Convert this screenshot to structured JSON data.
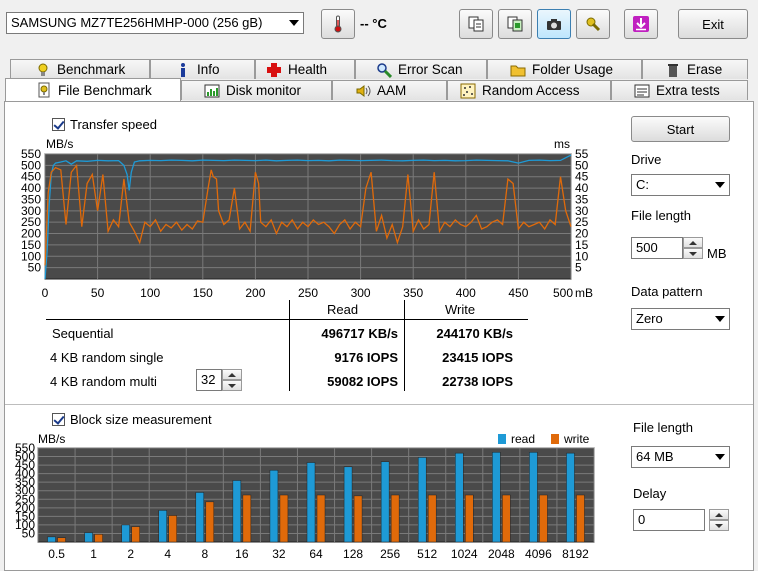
{
  "toolbar": {
    "drive_select": "SAMSUNG MZ7TE256HMHP-000 (256 gB)",
    "temperature": "-- °C",
    "exit_label": "Exit"
  },
  "tabs_top": [
    {
      "label": "Benchmark",
      "icon": "thermometer-icon"
    },
    {
      "label": "Info",
      "icon": "info-icon"
    },
    {
      "label": "Health",
      "icon": "health-cross-icon"
    },
    {
      "label": "Error Scan",
      "icon": "magnifier-icon"
    },
    {
      "label": "Folder Usage",
      "icon": "folder-icon"
    },
    {
      "label": "Erase",
      "icon": "trash-icon"
    }
  ],
  "tabs_bottom": [
    {
      "label": "File Benchmark",
      "icon": "file-benchmark-icon",
      "selected": true
    },
    {
      "label": "Disk monitor",
      "icon": "disk-monitor-icon"
    },
    {
      "label": "AAM",
      "icon": "speaker-icon"
    },
    {
      "label": "Random Access",
      "icon": "random-access-icon"
    },
    {
      "label": "Extra tests",
      "icon": "extra-tests-icon"
    }
  ],
  "transfer": {
    "checkbox_label": "Transfer speed",
    "left_unit": "MB/s",
    "right_unit": "ms",
    "x_unit": "mB"
  },
  "results": {
    "read_header": "Read",
    "write_header": "Write",
    "rows": [
      {
        "label": "Sequential",
        "read": "496717 KB/s",
        "write": "244170 KB/s"
      },
      {
        "label": "4 KB random single",
        "read": "9176 IOPS",
        "write": "23415 IOPS"
      },
      {
        "label": "4 KB random multi",
        "read": "59082 IOPS",
        "write": "22738 IOPS"
      }
    ],
    "queue_depth": "32"
  },
  "block": {
    "checkbox_label": "Block size measurement",
    "unit": "MB/s",
    "legend_read": "read",
    "legend_write": "write"
  },
  "right_panel": {
    "start_label": "Start",
    "drive_label": "Drive",
    "drive_value": "C:",
    "file_length_label": "File length",
    "file_length_value": "500",
    "file_length_unit": "MB",
    "pattern_label": "Data pattern",
    "pattern_value": "Zero",
    "block_file_length_label": "File length",
    "block_file_length_value": "64 MB",
    "delay_label": "Delay",
    "delay_value": "0"
  },
  "colors": {
    "read": "#1e9ad6",
    "write": "#e06a0a",
    "plot_bg": "#4a4a4a",
    "grid": "#7a7a7a"
  },
  "chart_data": [
    {
      "type": "line",
      "title": "Transfer speed",
      "xlim": [
        0,
        500
      ],
      "x_ticks": [
        0,
        50,
        100,
        150,
        200,
        250,
        300,
        350,
        400,
        450,
        500
      ],
      "ylim": [
        0,
        550
      ],
      "y_ticks": [
        50,
        100,
        150,
        200,
        250,
        300,
        350,
        400,
        450,
        500,
        550
      ],
      "y2lim": [
        0,
        55
      ],
      "y2_ticks": [
        5,
        10,
        15,
        20,
        25,
        30,
        35,
        40,
        45,
        50,
        55
      ],
      "grid": true,
      "series": [
        {
          "name": "read",
          "x": [
            0,
            2,
            4,
            6,
            8,
            10,
            15,
            20,
            25,
            30,
            40,
            50,
            60,
            70,
            75,
            78,
            80,
            82,
            85,
            90,
            100,
            110,
            120,
            130,
            140,
            150,
            160,
            170,
            180,
            190,
            200,
            210,
            220,
            230,
            240,
            250,
            260,
            270,
            280,
            290,
            300,
            310,
            320,
            330,
            340,
            350,
            360,
            370,
            380,
            390,
            400,
            410,
            420,
            430,
            440,
            450,
            460,
            470,
            480,
            490,
            500
          ],
          "y": [
            0,
            120,
            330,
            460,
            500,
            510,
            515,
            520,
            505,
            520,
            518,
            522,
            520,
            521,
            500,
            460,
            390,
            470,
            515,
            520,
            522,
            521,
            523,
            522,
            520,
            523,
            522,
            521,
            523,
            522,
            521,
            523,
            520,
            522,
            523,
            521,
            522,
            520,
            523,
            522,
            521,
            522,
            523,
            521,
            520,
            522,
            523,
            521,
            522,
            520,
            521,
            523,
            522,
            521,
            520,
            510,
            522,
            523,
            521,
            522,
            545
          ]
        },
        {
          "name": "write",
          "x": [
            0,
            3,
            6,
            10,
            15,
            20,
            25,
            30,
            35,
            40,
            45,
            50,
            55,
            60,
            65,
            70,
            75,
            80,
            85,
            90,
            95,
            100,
            105,
            110,
            115,
            120,
            125,
            130,
            135,
            140,
            145,
            150,
            155,
            158,
            160,
            163,
            165,
            170,
            175,
            180,
            185,
            190,
            195,
            200,
            203,
            205,
            210,
            215,
            220,
            225,
            230,
            235,
            240,
            245,
            250,
            255,
            260,
            265,
            270,
            275,
            280,
            285,
            290,
            295,
            300,
            305,
            310,
            315,
            320,
            325,
            330,
            335,
            340,
            345,
            350,
            355,
            360,
            365,
            370,
            375,
            380,
            385,
            390,
            395,
            400,
            405,
            410,
            415,
            420,
            425,
            430,
            435,
            440,
            445,
            450,
            455,
            460,
            465,
            470,
            475,
            480,
            485,
            490,
            495,
            500
          ],
          "y": [
            60,
            380,
            470,
            490,
            480,
            240,
            470,
            500,
            230,
            420,
            460,
            300,
            460,
            210,
            260,
            230,
            440,
            250,
            210,
            160,
            250,
            230,
            260,
            210,
            240,
            225,
            250,
            215,
            240,
            220,
            255,
            250,
            400,
            480,
            450,
            440,
            300,
            240,
            260,
            400,
            220,
            250,
            210,
            470,
            420,
            250,
            230,
            260,
            200,
            250,
            230,
            260,
            220,
            250,
            230,
            260,
            240,
            250,
            230,
            200,
            240,
            260,
            220,
            250,
            230,
            400,
            470,
            210,
            280,
            180,
            240,
            160,
            230,
            460,
            210,
            260,
            220,
            240,
            470,
            210,
            250,
            230,
            260,
            240,
            230,
            250,
            280,
            220,
            230,
            250,
            260,
            240,
            440,
            420,
            220,
            250,
            230,
            240,
            250,
            220,
            260,
            240,
            450,
            300,
            230
          ]
        }
      ]
    },
    {
      "type": "bar",
      "title": "Block size measurement",
      "categories": [
        "0.5",
        "1",
        "2",
        "4",
        "8",
        "16",
        "32",
        "64",
        "128",
        "256",
        "512",
        "1024",
        "2048",
        "4096",
        "8192"
      ],
      "ylim": [
        0,
        550
      ],
      "y_ticks": [
        50,
        100,
        150,
        200,
        250,
        300,
        350,
        400,
        450,
        500,
        550
      ],
      "grid": true,
      "legend": "top-right",
      "series": [
        {
          "name": "read",
          "values": [
            30,
            55,
            100,
            185,
            290,
            360,
            420,
            465,
            440,
            470,
            495,
            520,
            525,
            525,
            520
          ]
        },
        {
          "name": "write",
          "values": [
            25,
            45,
            90,
            155,
            235,
            275,
            275,
            275,
            270,
            275,
            275,
            275,
            275,
            275,
            275
          ]
        }
      ]
    }
  ]
}
